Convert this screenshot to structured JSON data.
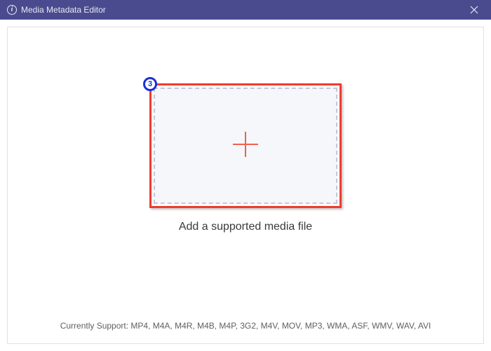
{
  "titlebar": {
    "title": "Media Metadata Editor"
  },
  "annotation": {
    "step_number": "3"
  },
  "dropzone": {
    "caption": "Add a supported media file"
  },
  "footer": {
    "text": "Currently Support: MP4, M4A, M4R, M4B, M4P, 3G2, M4V, MOV, MP3, WMA, ASF, WMV, WAV, AVI"
  }
}
